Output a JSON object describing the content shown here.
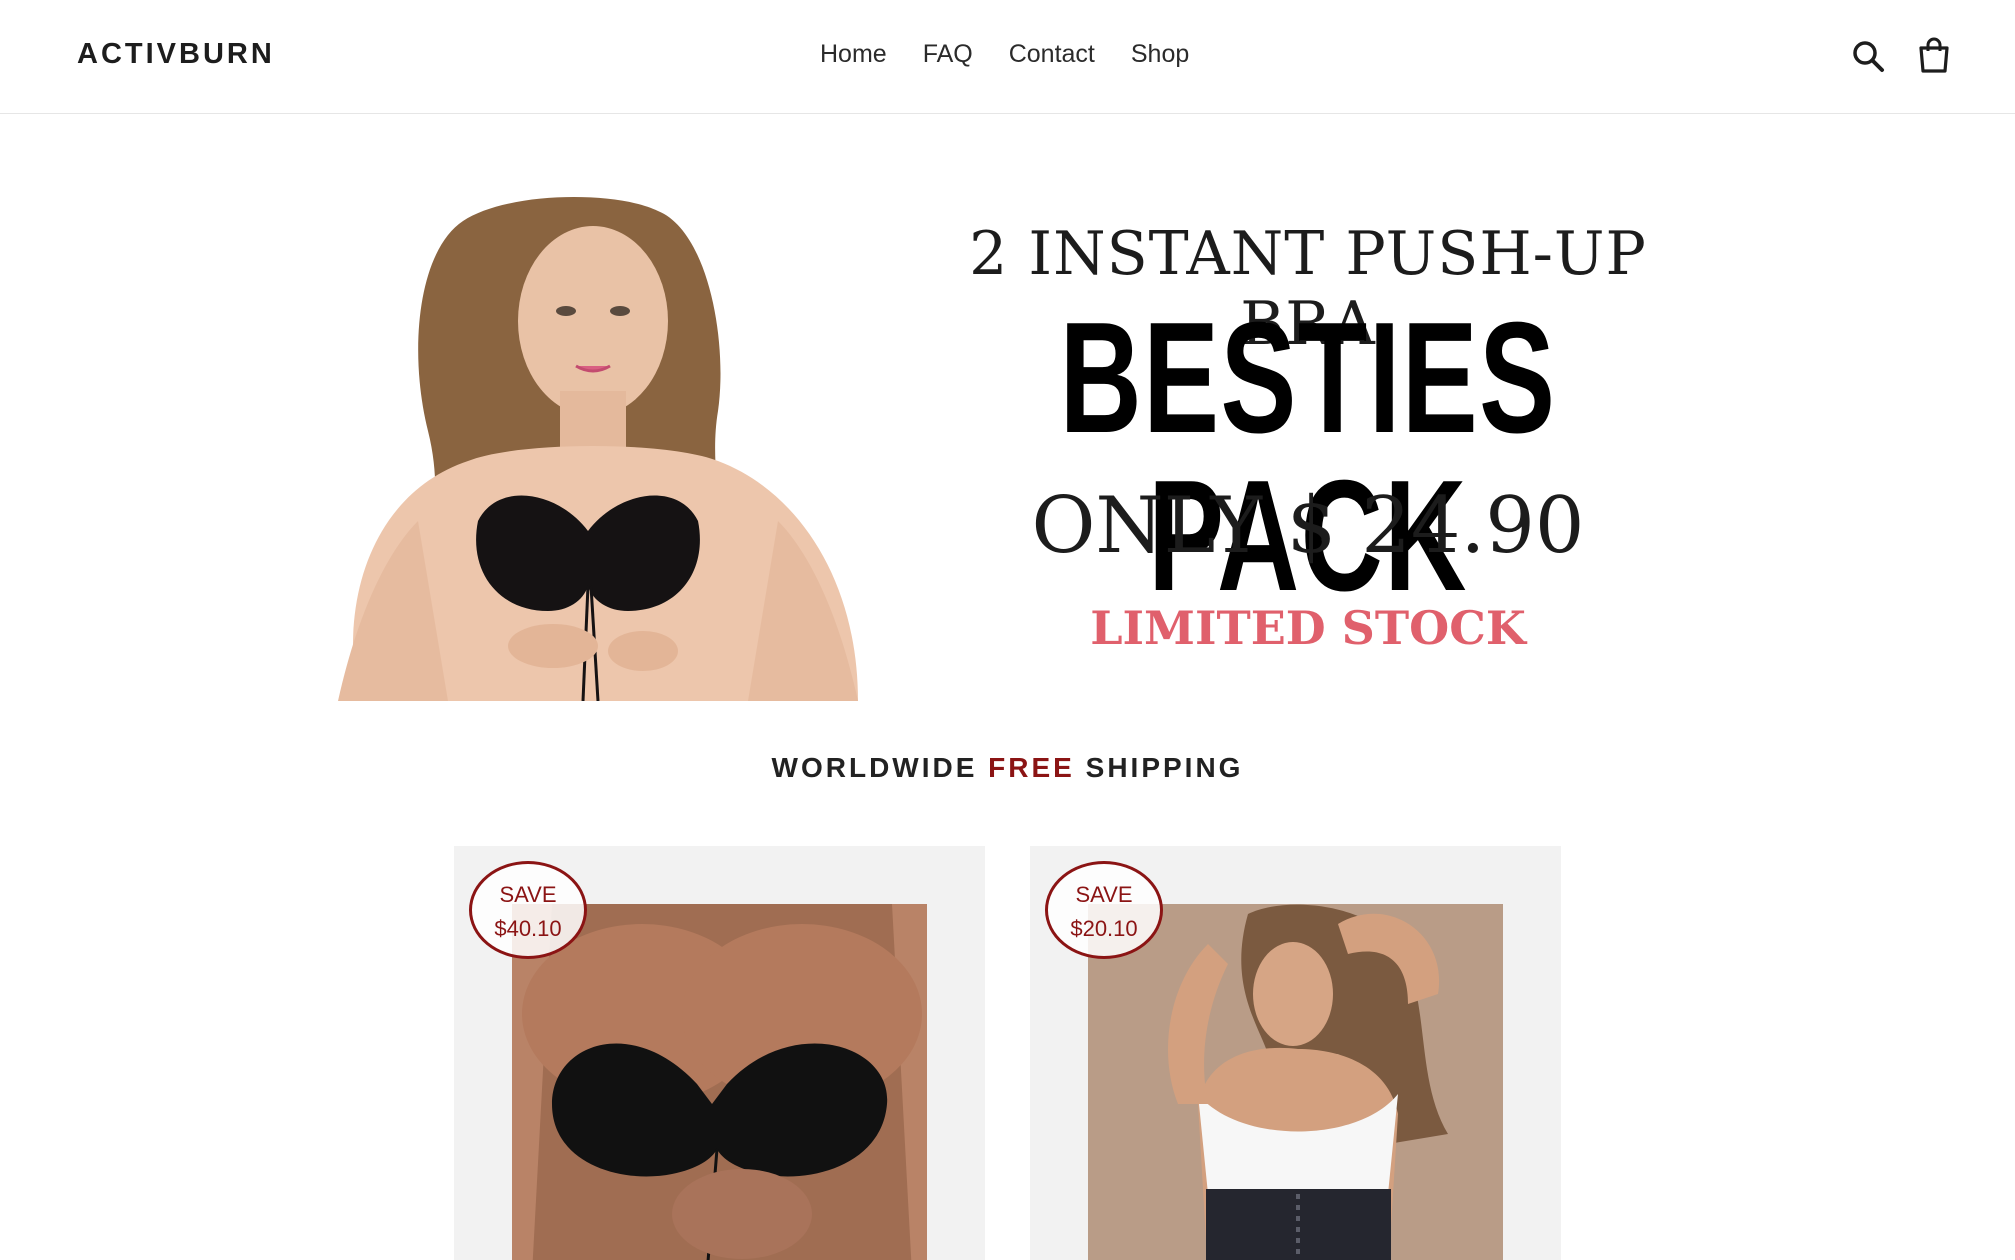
{
  "header": {
    "logo": "ACTIVBURN",
    "nav": [
      {
        "label": "Home"
      },
      {
        "label": "FAQ"
      },
      {
        "label": "Contact"
      },
      {
        "label": "Shop"
      }
    ],
    "icons": {
      "search": "search-icon",
      "cart": "cart-icon"
    }
  },
  "hero": {
    "line1": "2 INSTANT PUSH-UP BRA",
    "line2": "BESTIES PACK",
    "line3": "ONLY $ 24.90",
    "line4": "LIMITED STOCK",
    "colors": {
      "accent": "#e0606c"
    }
  },
  "shipping": {
    "part1": "WORLDWIDE ",
    "part2": "FREE",
    "part3": " SHIPPING",
    "accent": "#8b1414"
  },
  "products": [
    {
      "badge_top": "SAVE",
      "badge_amount": "$40.10"
    },
    {
      "badge_top": "SAVE",
      "badge_amount": "$20.10"
    }
  ]
}
